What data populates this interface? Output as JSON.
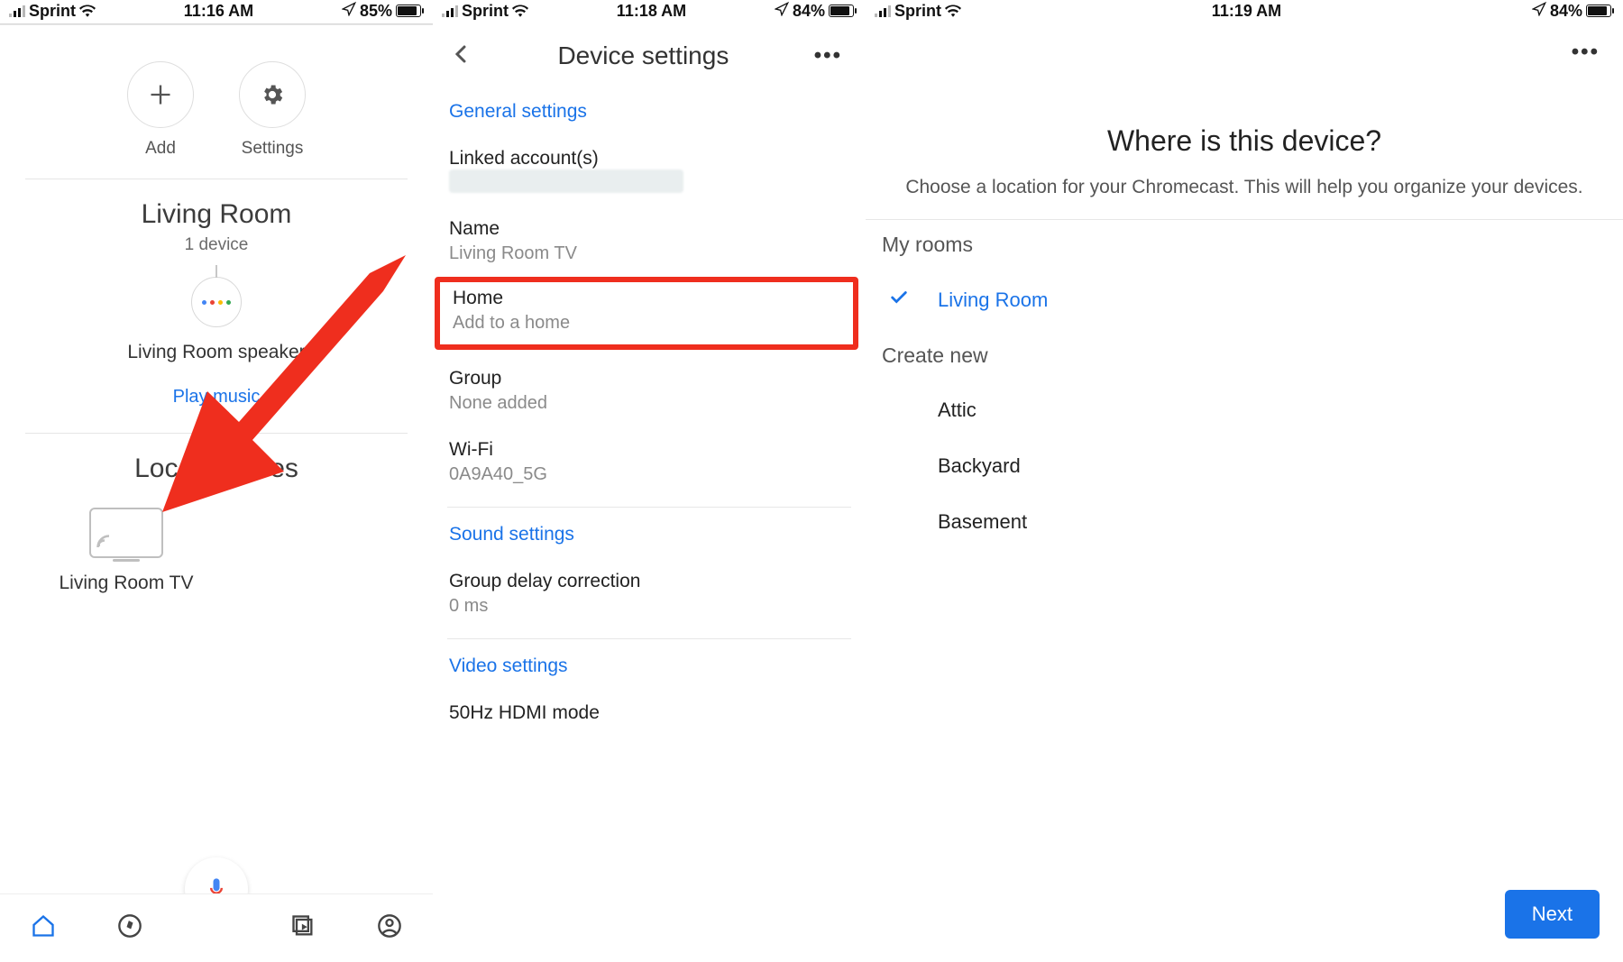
{
  "screens": [
    {
      "status": {
        "carrier": "Sprint",
        "time": "11:16 AM",
        "battery_pct": "85%"
      },
      "top_buttons": {
        "add": "Add",
        "settings": "Settings"
      },
      "room_header": {
        "title": "Living Room",
        "subtitle": "1 device"
      },
      "speaker": {
        "name": "Living Room speaker",
        "action": "Play music"
      },
      "local_devices": {
        "title": "Local devices",
        "tv_name": "Living Room TV"
      }
    },
    {
      "status": {
        "carrier": "Sprint",
        "time": "11:18 AM",
        "battery_pct": "84%"
      },
      "header": {
        "title": "Device settings"
      },
      "sections": {
        "general": "General settings",
        "linked_accounts": {
          "label": "Linked account(s)"
        },
        "name": {
          "label": "Name",
          "value": "Living Room TV"
        },
        "home": {
          "label": "Home",
          "value": "Add to a home"
        },
        "group": {
          "label": "Group",
          "value": "None added"
        },
        "wifi": {
          "label": "Wi-Fi",
          "value": "0A9A40_5G"
        },
        "sound": "Sound settings",
        "group_delay": {
          "label": "Group delay correction",
          "value": "0 ms"
        },
        "video": "Video settings",
        "hdmi_50": {
          "label": "50Hz HDMI mode"
        }
      }
    },
    {
      "status": {
        "carrier": "Sprint",
        "time": "11:19 AM",
        "battery_pct": "84%"
      },
      "question": {
        "title": "Where is this device?",
        "subtitle": "Choose a location for your Chromecast. This will help you organize your devices."
      },
      "my_rooms": {
        "label": "My rooms",
        "items": [
          "Living Room"
        ],
        "selected": "Living Room"
      },
      "create_new": {
        "label": "Create new",
        "items": [
          "Attic",
          "Backyard",
          "Basement"
        ]
      },
      "next": "Next"
    }
  ],
  "colors": {
    "accent": "#1a73e8",
    "annotation": "#ef2e1e"
  }
}
